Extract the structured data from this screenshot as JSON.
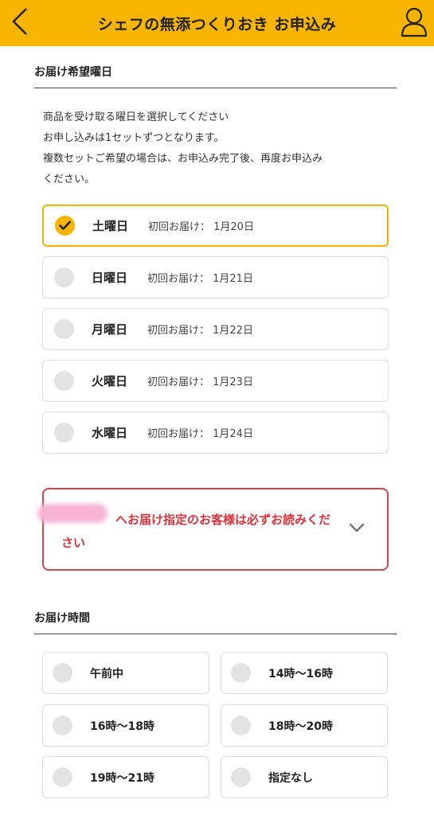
{
  "header": {
    "title": "シェフの無添つくりおき お申込み",
    "accent_color": "#f7b500",
    "back_icon": "chevron-left-icon",
    "user_icon": "user-icon"
  },
  "delivery_day": {
    "heading": "お届け希望曜日",
    "description": [
      "商品を受け取る曜日を選択してください",
      "お申し込みは1セットずつとなります。",
      "複数セットご希望の場合は、お申込み完了後、再度お申込み",
      "ください。"
    ],
    "options": [
      {
        "day": "土曜日",
        "first": "初回お届け： 1月20日",
        "selected": true
      },
      {
        "day": "日曜日",
        "first": "初回お届け： 1月21日",
        "selected": false
      },
      {
        "day": "月曜日",
        "first": "初回お届け： 1月22日",
        "selected": false
      },
      {
        "day": "火曜日",
        "first": "初回お届け： 1月23日",
        "selected": false
      },
      {
        "day": "水曜日",
        "first": "初回お届け： 1月24日",
        "selected": false
      }
    ]
  },
  "notice": {
    "text": "へお届け指定のお客様は必ずお読みください",
    "color": "#e0303a"
  },
  "delivery_time": {
    "heading": "お届け時間",
    "options": [
      {
        "label": "午前中",
        "selected": false
      },
      {
        "label": "14時〜16時",
        "selected": false
      },
      {
        "label": "16時〜18時",
        "selected": false
      },
      {
        "label": "18時〜20時",
        "selected": false
      },
      {
        "label": "19時〜21時",
        "selected": false
      },
      {
        "label": "指定なし",
        "selected": false
      }
    ]
  }
}
